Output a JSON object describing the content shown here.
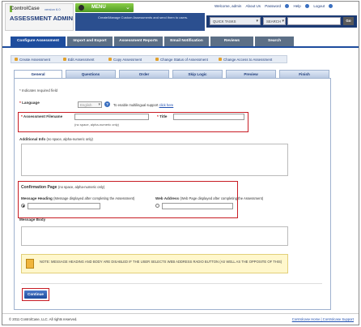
{
  "header": {
    "logo_text": "ControlCase",
    "logo_version": "version 6.0",
    "app_title": "ASSESSMENT ADMIN",
    "menu_label": "MENU",
    "description": "Create/Manage Custom Assessments and send them to users.",
    "util_links": [
      "Welcome, admin",
      "About Us",
      "Password",
      "Help",
      "Logout"
    ],
    "quick_tasks": "QUICK TASKS",
    "search_label": "SEARCH",
    "go_label": "Go"
  },
  "main_nav": {
    "tabs": [
      "Configure Assessment",
      "Import and Export",
      "Assessment Reports",
      "Email Notification",
      "Reviews",
      "Search"
    ]
  },
  "sub_nav": {
    "items": [
      "Create Assessment",
      "Edit Assessment",
      "Copy Assessment",
      "Change Status of Assessment",
      "Change Access to Assessment"
    ]
  },
  "form_tabs": {
    "tabs": [
      "General",
      "Questions",
      "Order",
      "Skip Logic",
      "Preview",
      "Finish"
    ]
  },
  "form": {
    "required_note": "* Indicates required field",
    "language_label": "Language",
    "language_value": "English",
    "language_hint": "To enable multilingual support",
    "language_link": "click here",
    "filename_label": "Assessment Filename",
    "filename_hint": "(no space, alpha-numeric only)",
    "title_label": "Title",
    "additional_info_label": "Additional Info",
    "additional_info_hint": "(no space, alpha-numeric only)",
    "confirmation_title": "Confirmation Page",
    "confirmation_sub": "(no space, alpha-numeric only)",
    "message_heading_label": "Message Heading",
    "message_heading_hint": "(Message displayed after completing the Assessment)",
    "web_address_label": "Web Address",
    "web_address_hint": "(Web Page displayed after completing the Assessment)",
    "message_body_label": "Message Body",
    "note": "NOTE: MESSAGE HEADING AND BODY ARE DISABLED IF THE USER SELECTS WEB ADDRESS RADIO BUTTON (AS WELL AS THE OPPOSITE OF THIS)",
    "continue_label": "Continue"
  },
  "footer": {
    "copyright": "© 2011 ControlCase, LLC. All rights reserved.",
    "links": "Controlcase Home | Controlcase Support"
  },
  "colors": {
    "nav_active": "#1e4d9e",
    "nav_inactive": "#5c6f86",
    "highlight_red": "#c81d25",
    "menu_green": "#6cb33a"
  }
}
